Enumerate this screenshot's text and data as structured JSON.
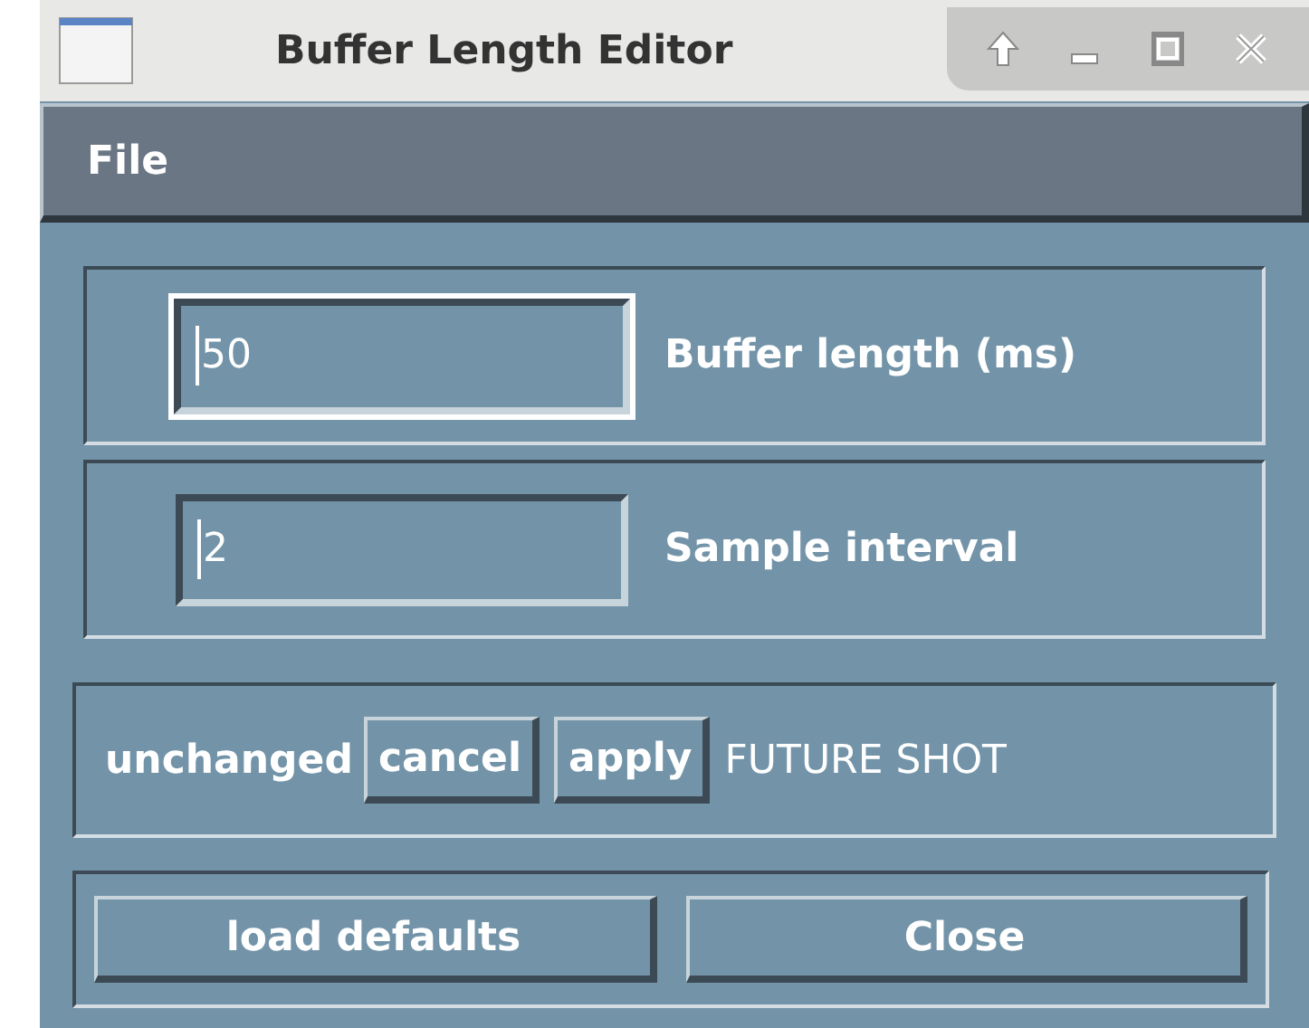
{
  "window": {
    "title": "Buffer Length Editor"
  },
  "menu": [
    {
      "label": "File"
    }
  ],
  "fields": [
    {
      "value": "50",
      "label": "Buffer length (ms)",
      "focused": true
    },
    {
      "value": "2",
      "label": "Sample interval",
      "focused": false
    }
  ],
  "status": "unchanged",
  "actions": [
    {
      "label": "cancel"
    },
    {
      "label": "apply"
    }
  ],
  "note": "FUTURE SHOT",
  "buttons": [
    {
      "label": "load defaults"
    },
    {
      "label": "Close"
    }
  ]
}
